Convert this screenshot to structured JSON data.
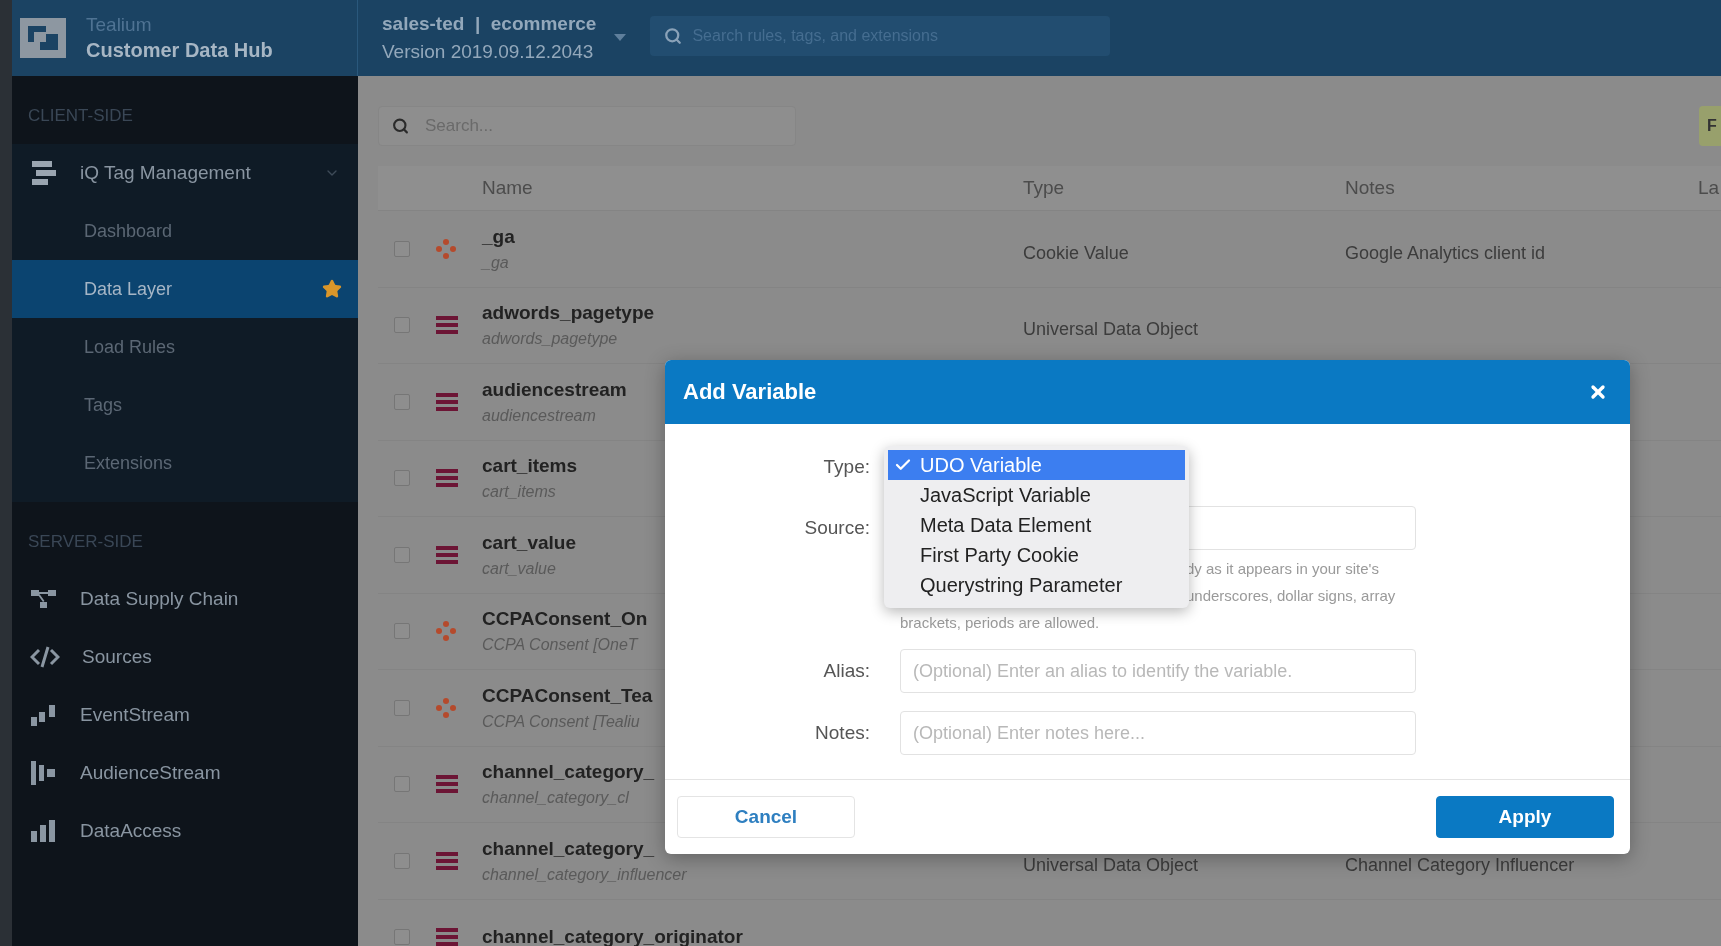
{
  "header": {
    "brand": "Tealium",
    "product": "Customer Data Hub",
    "account": "sales-ted  |  ecommerce",
    "version": "Version 2019.09.12.2043",
    "search": {
      "placeholder": "Search rules, tags, and extensions"
    }
  },
  "sidebar": {
    "sections": [
      {
        "heading": "CLIENT-SIDE",
        "items": [
          {
            "kind": "tag-manager",
            "label": "iQ Tag Management",
            "selected": false,
            "expanded": true,
            "children": [
              {
                "label": "Dashboard",
                "selected": false,
                "starred": false
              },
              {
                "label": "Data Layer",
                "selected": true,
                "starred": true
              },
              {
                "label": "Load Rules",
                "selected": false,
                "starred": false
              },
              {
                "label": "Tags",
                "selected": false,
                "starred": false
              },
              {
                "label": "Extensions",
                "selected": false,
                "starred": false
              }
            ]
          }
        ]
      },
      {
        "heading": "SERVER-SIDE",
        "items": [
          {
            "kind": "supply-chain",
            "label": "Data Supply Chain",
            "selected": false
          },
          {
            "kind": "sources",
            "label": "Sources",
            "selected": false
          },
          {
            "kind": "eventstream",
            "label": "EventStream",
            "selected": false
          },
          {
            "kind": "audiencestream",
            "label": "AudienceStream",
            "selected": false
          },
          {
            "kind": "dataaccess",
            "label": "DataAccess",
            "selected": false
          }
        ]
      }
    ]
  },
  "content": {
    "search": {
      "placeholder": "Search..."
    },
    "filter_button": "F",
    "table": {
      "columns": [
        "Name",
        "Type",
        "Notes",
        "La"
      ],
      "rows": [
        {
          "kind": "cookie",
          "checked": false,
          "name": "_ga",
          "subname": "_ga",
          "type": "Cookie Value",
          "notes": "Google Analytics client id"
        },
        {
          "kind": "udo",
          "checked": false,
          "name": "adwords_pagetype",
          "subname": "adwords_pagetype",
          "type": "Universal Data Object"
        },
        {
          "kind": "udo",
          "checked": false,
          "name": "audiencestream",
          "subname": "audiencestream"
        },
        {
          "kind": "udo",
          "checked": false,
          "name": "cart_items",
          "subname": "cart_items"
        },
        {
          "kind": "udo",
          "checked": false,
          "name": "cart_value",
          "subname": "cart_value"
        },
        {
          "kind": "cookie",
          "checked": false,
          "name": "CCPAConsent_On",
          "subname": "CCPA Consent [OneT"
        },
        {
          "kind": "cookie",
          "checked": false,
          "name": "CCPAConsent_Tea",
          "subname": "CCPA Consent [Tealiu"
        },
        {
          "kind": "udo",
          "checked": false,
          "name": "channel_category_",
          "subname": "channel_category_cl"
        },
        {
          "kind": "udo",
          "checked": false,
          "name": "channel_category_",
          "subname": "channel_category_influencer",
          "type": "Universal Data Object",
          "notes": "Channel Category Influencer"
        },
        {
          "kind": "udo",
          "checked": false,
          "name": "channel_category_originator"
        }
      ]
    }
  },
  "modal": {
    "title": "Add Variable",
    "fields": [
      {
        "kind": "select",
        "label": "Type:",
        "options": [
          {
            "label": "UDO Variable",
            "selected": true
          },
          {
            "label": "JavaScript Variable",
            "selected": false
          },
          {
            "label": "Meta Data Element",
            "selected": false
          },
          {
            "label": "First Party Cookie",
            "selected": false
          },
          {
            "label": "Querystring Parameter",
            "selected": false
          }
        ]
      },
      {
        "kind": "input",
        "label": "Source:",
        "hint_lines": [
          "dy as it appears in your site's",
          "underscores, dollar signs, array",
          "brackets, periods are allowed."
        ]
      },
      {
        "kind": "input",
        "label": "Alias:",
        "placeholder": "(Optional) Enter an alias to identify the variable."
      },
      {
        "kind": "input",
        "label": "Notes:",
        "placeholder": "(Optional) Enter notes here..."
      }
    ],
    "buttons": [
      {
        "kind": "secondary",
        "label": "Cancel"
      },
      {
        "kind": "primary",
        "label": "Apply"
      }
    ]
  }
}
